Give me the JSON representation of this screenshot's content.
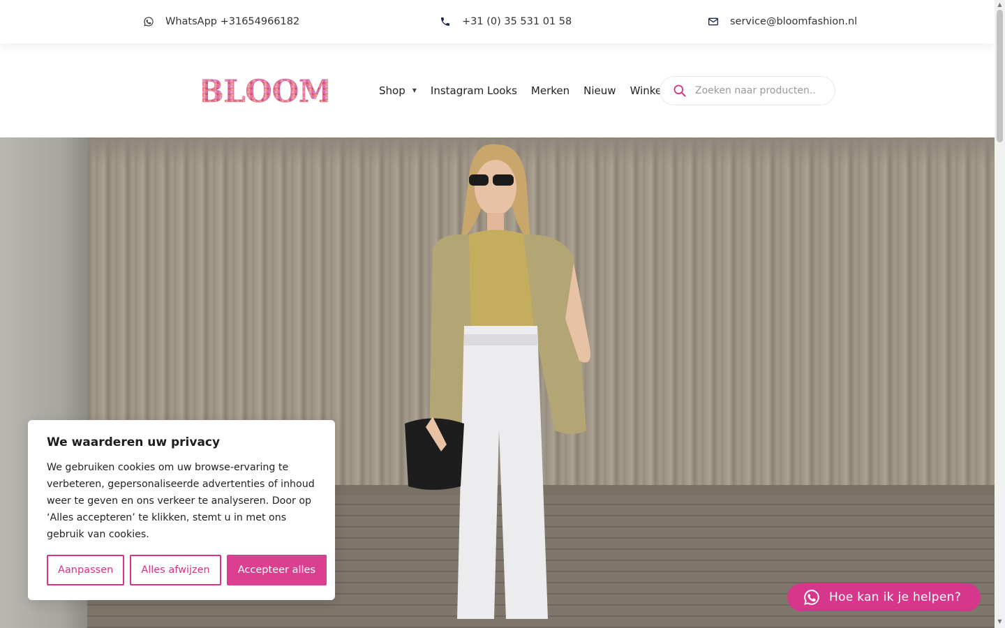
{
  "topbar": {
    "whatsapp_label": "WhatsApp +31654966182",
    "phone_label": "+31 (0) 35 531 01 58",
    "email_label": "service@bloomfashion.nl"
  },
  "header": {
    "logo_text": "BLOOM",
    "nav": {
      "shop": "Shop",
      "instagram": "Instagram Looks",
      "merken": "Merken",
      "nieuw": "Nieuw",
      "winkel": "Winkel"
    },
    "search_placeholder": "Zoeken naar producten.."
  },
  "cookie": {
    "title": "We waarderen uw privacy",
    "text": "We gebruiken cookies om uw browse-ervaring te verbeteren, gepersonaliseerde advertenties of inhoud weer te geven en ons verkeer te analyseren. Door op ‘Alles accepteren’ te klikken, stemt u in met ons gebruik van cookies.",
    "customize": "Aanpassen",
    "reject": "Alles afwijzen",
    "accept": "Accepteer alles"
  },
  "chat": {
    "label": "Hoe kan ik je helpen?"
  },
  "colors": {
    "accent": "#db3f8f",
    "text": "#222222"
  },
  "icons": [
    "whatsapp-icon",
    "phone-icon",
    "mail-icon",
    "search-icon",
    "caret-down-icon"
  ]
}
